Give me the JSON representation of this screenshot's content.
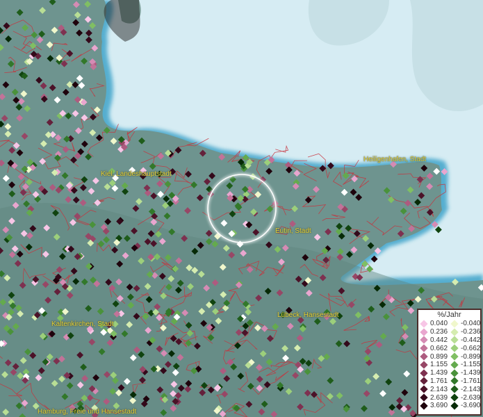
{
  "places": [
    {
      "key": "kiel",
      "label": "Kiel, Landeshauptstadt"
    },
    {
      "key": "heiligenhafen",
      "label": "Heiligenhafen, Stadt"
    },
    {
      "key": "eutin",
      "label": "Eutin, Stadt"
    },
    {
      "key": "luebeck",
      "label": "Lübeck, Hansestadt"
    },
    {
      "key": "kaltenkirchen",
      "label": "Kaltenkirchen, Stadt"
    },
    {
      "key": "hamburg",
      "label": "Hamburg, Freie und Hansestadt"
    }
  ],
  "legend": {
    "title": "%/Jahr",
    "positive": [
      {
        "value": "0.040",
        "color": "#f7c6e6"
      },
      {
        "value": "0.236",
        "color": "#e9a6cf"
      },
      {
        "value": "0.442",
        "color": "#d58bb4"
      },
      {
        "value": "0.662",
        "color": "#c27399"
      },
      {
        "value": "0.899",
        "color": "#ad5b7f"
      },
      {
        "value": "1.155",
        "color": "#974766"
      },
      {
        "value": "1.439",
        "color": "#7e3150"
      },
      {
        "value": "1.761",
        "color": "#64213b"
      },
      {
        "value": "2.143",
        "color": "#4b1228"
      },
      {
        "value": "2.639",
        "color": "#33091a"
      },
      {
        "value": "3.690",
        "color": "#1e030c"
      }
    ],
    "negative": [
      {
        "value": "-0.040",
        "color": "#f0f7cc"
      },
      {
        "value": "-0.236",
        "color": "#d5ecb0"
      },
      {
        "value": "-0.442",
        "color": "#b8de95"
      },
      {
        "value": "-0.662",
        "color": "#9ccf7b"
      },
      {
        "value": "-0.899",
        "color": "#80bf63"
      },
      {
        "value": "-1.155",
        "color": "#64aa4e"
      },
      {
        "value": "-1.439",
        "color": "#4a923b"
      },
      {
        "value": "-1.761",
        "color": "#32782a"
      },
      {
        "value": "-2.143",
        "color": "#1f5d1b"
      },
      {
        "value": "-2.639",
        "color": "#10430f"
      },
      {
        "value": "-3.690",
        "color": "#062a06"
      }
    ]
  },
  "colors": {
    "sea": "#d6ecf3",
    "land": "#6e948f",
    "borders": "#c8323c",
    "highlight_circle": "#ffffff",
    "label": "#e6d23a"
  }
}
